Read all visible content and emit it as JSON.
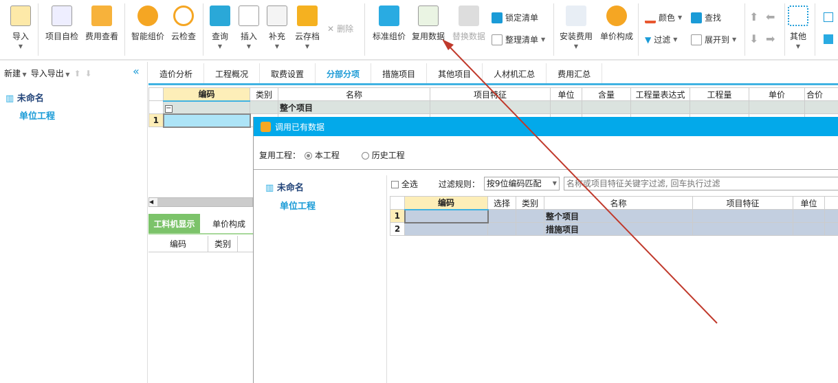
{
  "toolbar": {
    "import": "导入",
    "self_check": "项目自检",
    "fee_view": "费用查看",
    "smart_price": "智能组价",
    "cloud_check": "云检查",
    "query": "查询",
    "insert": "插入",
    "supplement": "补充",
    "cloud_archive": "云存档",
    "delete": "删除",
    "std_price": "标准组价",
    "reuse_data": "复用数据",
    "replace_data": "替换数据",
    "lock_list": "锁定清单",
    "tidy_list": "整理清单",
    "install_fee": "安装费用",
    "unit_price_comp": "单价构成",
    "color": "颜色",
    "find": "查找",
    "filter": "过滤",
    "expand_to": "展开到",
    "other": "其他"
  },
  "left": {
    "new": "新建",
    "import_export": "导入导出",
    "tree": {
      "root": "未命名",
      "child": "单位工程"
    }
  },
  "tabs": [
    "造价分析",
    "工程概况",
    "取费设置",
    "分部分项",
    "措施项目",
    "其他项目",
    "人材机汇总",
    "费用汇总"
  ],
  "main_grid": {
    "headers": [
      "编码",
      "类别",
      "名称",
      "项目特征",
      "单位",
      "含量",
      "工程量表达式",
      "工程量",
      "单价",
      "合价"
    ],
    "group_row": "整个项目",
    "row1_no": "1"
  },
  "bottom": {
    "tabs": [
      "工料机显示",
      "单价构成"
    ],
    "headers": [
      "编码",
      "类别"
    ]
  },
  "dialog": {
    "title": "调用已有数据",
    "reuse_label": "复用工程：",
    "options": [
      "本工程",
      "历史工程"
    ],
    "selected": "本工程",
    "tree": {
      "root": "未命名",
      "child": "单位工程"
    },
    "select_all": "全选",
    "filter_rule_label": "过滤规则：",
    "filter_rule": "按9位编码匹配",
    "filter_placeholder": "名称或项目特征关键字过滤, 回车执行过滤",
    "headers": [
      "编码",
      "选择",
      "类别",
      "名称",
      "项目特征",
      "单位"
    ],
    "rows": [
      {
        "no": "1",
        "name": "整个项目"
      },
      {
        "no": "2",
        "name": "措施项目"
      }
    ]
  },
  "colors": {
    "accent": "#03a9ea",
    "tab_active": "#1d9bd6",
    "green_tab": "#7cc36a",
    "annotation_arrow": "#c0392b"
  }
}
